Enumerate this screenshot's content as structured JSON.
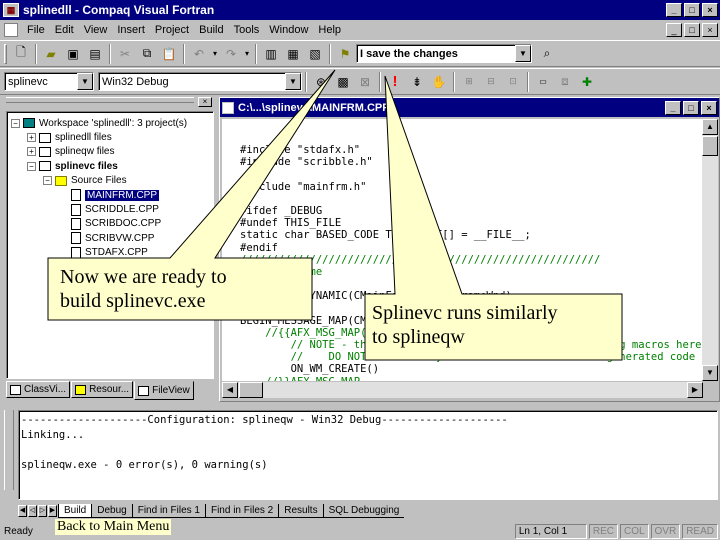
{
  "window": {
    "title_prefix": "splinedll - ",
    "title_app": "Compaq Visual Fortran",
    "btn_minimize": "_",
    "btn_maximize": "□",
    "btn_close": "×"
  },
  "menu": [
    "File",
    "Edit",
    "View",
    "Insert",
    "Project",
    "Build",
    "Tools",
    "Window",
    "Help"
  ],
  "toolbar": {
    "find_combo_value": "I save the changes",
    "project_combo_value": "splinevc",
    "config_combo_value": "Win32 Debug"
  },
  "workspace": {
    "tree": [
      {
        "indent": 0,
        "expander": "−",
        "icon": "ws",
        "label": "Workspace 'splinedll': 3 project(s)"
      },
      {
        "indent": 1,
        "expander": "+",
        "icon": "proj",
        "label": "splinedll files"
      },
      {
        "indent": 1,
        "expander": "+",
        "icon": "proj",
        "label": "splineqw files"
      },
      {
        "indent": 1,
        "expander": "−",
        "icon": "proj",
        "label": "splinevc files",
        "bold": true
      },
      {
        "indent": 2,
        "expander": "−",
        "icon": "folder",
        "label": "Source Files"
      },
      {
        "indent": 3,
        "expander": "",
        "icon": "file",
        "label": "MAINFRM.CPP",
        "selected": true
      },
      {
        "indent": 3,
        "expander": "",
        "icon": "file",
        "label": "SCRIDDLE.CPP"
      },
      {
        "indent": 3,
        "expander": "",
        "icon": "file",
        "label": "SCRIBDOC.CPP"
      },
      {
        "indent": 3,
        "expander": "",
        "icon": "file",
        "label": "SCRIBVW.CPP"
      },
      {
        "indent": 3,
        "expander": "",
        "icon": "file",
        "label": "STDAFX.CPP"
      }
    ],
    "tabs": [
      "ClassVi...",
      "Resour...",
      "FileView"
    ]
  },
  "editor": {
    "title": "C:\\...\\splinevc\\MAINFRM.CPP",
    "lines": [
      {
        "kind": "normal",
        "text": "#include \"stdafx.h\""
      },
      {
        "kind": "normal",
        "text": "#include \"scribble.h\""
      },
      {
        "kind": "normal",
        "text": ""
      },
      {
        "kind": "normal",
        "text": "#include \"mainfrm.h\""
      },
      {
        "kind": "normal",
        "text": ""
      },
      {
        "kind": "normal",
        "text": "#ifdef _DEBUG"
      },
      {
        "kind": "normal",
        "text": "#undef THIS_FILE"
      },
      {
        "kind": "normal",
        "text": "static char BASED_CODE THIS_FILE[] = __FILE__;"
      },
      {
        "kind": "normal",
        "text": "#endif"
      },
      {
        "kind": "comment",
        "text": "/////////////////////////////////////////////////////////"
      },
      {
        "kind": "comment",
        "text": "// CMainFrame"
      },
      {
        "kind": "normal",
        "text": ""
      },
      {
        "kind": "normal",
        "text": "IMPLEMENT_DYNAMIC(CMainFrame, CMDIFrameWnd)"
      },
      {
        "kind": "normal",
        "text": ""
      },
      {
        "kind": "normal",
        "text": "BEGIN_MESSAGE_MAP(CMainFrame, CMDIFrameWnd)"
      },
      {
        "kind": "comment",
        "text": "    //{{AFX_MSG_MAP(CMainFrame)"
      },
      {
        "kind": "comment",
        "text": "        // NOTE - the ClassWizard will add and remove mapping macros here."
      },
      {
        "kind": "comment",
        "text": "        //    DO NOT EDIT what you see in these blocks of generated code !"
      },
      {
        "kind": "normal",
        "text": "        ON_WM_CREATE()"
      },
      {
        "kind": "comment",
        "text": "    //}}AFX_MSG_MAP"
      }
    ]
  },
  "output": {
    "lines": [
      "--------------------Configuration: splineqw - Win32 Debug--------------------",
      "Linking...",
      "",
      "splineqw.exe - 0 error(s), 0 warning(s)"
    ],
    "tabs": [
      "Build",
      "Debug",
      "Find in Files 1",
      "Find in Files 2",
      "Results",
      "SQL Debugging"
    ]
  },
  "statusbar": {
    "status": "Ready",
    "position": "Ln 1, Col 1",
    "indicators": [
      "REC",
      "COL",
      "OVR",
      "READ"
    ]
  },
  "callouts": {
    "build_note": [
      "Now we are ready to",
      "build splinevc.exe"
    ],
    "run_note": [
      "Splinevc runs similarly",
      "to splineqw"
    ],
    "back_link": "Back to Main Menu",
    "fill": "#ffffcc"
  },
  "colors": {
    "title_bar": "#000080",
    "face": "#c0c0c0",
    "comment": "#008000"
  }
}
